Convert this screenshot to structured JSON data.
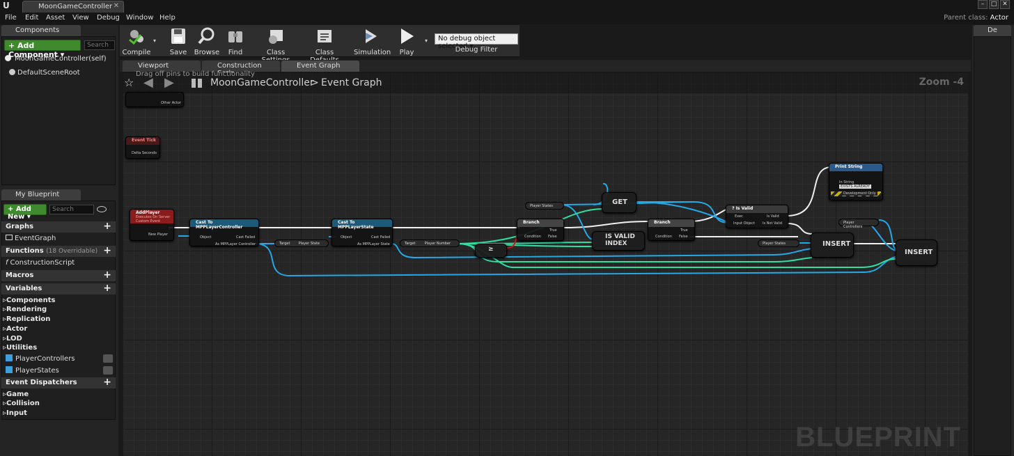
{
  "title_bar": {
    "logo": "unreal-logo",
    "tab": "MoonGameController",
    "window_buttons": [
      "–",
      "□",
      "✕"
    ]
  },
  "menu": {
    "items": [
      "File",
      "Edit",
      "Asset",
      "View",
      "Debug",
      "Window",
      "Help"
    ],
    "parent_class_label": "Parent class:",
    "parent_class_value": "Actor"
  },
  "components": {
    "tab": "Components",
    "add_button": "+ Add Component ▾",
    "search_placeholder": "Search",
    "items": [
      "MoonGameController(self)",
      "DefaultSceneRoot"
    ]
  },
  "my_blueprint": {
    "tab": "My Blueprint",
    "add_new": "+ Add New ▾",
    "search_placeholder": "Search",
    "graphs": "Graphs",
    "event_graph": "EventGraph",
    "functions": "Functions",
    "functions_count": "(18 Overridable)",
    "construction_script": "ConstructionScript",
    "macros": "Macros",
    "variables": "Variables",
    "var_categories": [
      "Components",
      "Rendering",
      "Replication",
      "Actor",
      "LOD",
      "Utilities"
    ],
    "vars": [
      "PlayerControllers",
      "PlayerStates"
    ],
    "event_dispatchers": "Event Dispatchers",
    "dispatcher_categories": [
      "Game",
      "Collision",
      "Input"
    ]
  },
  "toolbar": {
    "compile": "Compile",
    "save": "Save",
    "browse": "Browse",
    "find": "Find",
    "class_settings": "Class Settings",
    "class_defaults": "Class Defaults",
    "simulation": "Simulation",
    "play": "Play",
    "debug_object": "No debug object selected ▾",
    "debug_filter": "Debug Filter"
  },
  "details_tab": "De",
  "graph_tabs": [
    "Viewport",
    "Construction Scrip",
    "Event Graph"
  ],
  "graph": {
    "hint": "Drag off pins to build functionality",
    "breadcrumb_root": "MoonGameController",
    "breadcrumb_sep": ">",
    "breadcrumb_current": "Event Graph",
    "zoom": "Zoom -4",
    "watermark": "BLUEPRINT"
  },
  "nodes": {
    "other_actor": "Other Actor",
    "event_tick": "Event Tick",
    "delta_seconds": "Delta Seconds",
    "add_player": {
      "title": "AddPlayer",
      "subtitle": "Executes On Server",
      "subtitle2": "Custom Event",
      "pin": "New Player"
    },
    "cast_pc": {
      "title": "Cast To MPPLayerController",
      "object": "Object",
      "failed": "Cast Failed",
      "as": "As MPPLayer Controller"
    },
    "target_ps": {
      "target": "Target",
      "value": "Player State"
    },
    "cast_ps": {
      "title": "Cast To MPPLayerState",
      "object": "Object",
      "failed": "Cast Failed",
      "as": "As MPPLayer State"
    },
    "target_pn": {
      "target": "Target",
      "value": "Player Number"
    },
    "branch1": {
      "title": "Branch",
      "condition": "Condition",
      "true": "True",
      "false": "False"
    },
    "player_states_get": "Player States",
    "get": "GET",
    "is_valid_index": "IS VALID INDEX",
    "branch2": {
      "title": "Branch",
      "condition": "Condition",
      "true": "True",
      "false": "False"
    },
    "is_valid": {
      "title": "? Is Valid",
      "exec": "Exec",
      "input": "Input Object",
      "valid": "Is Valid",
      "not_valid": "Is Not Valid"
    },
    "print_string": {
      "title": "Print String",
      "in_string": "In String",
      "value": "EXISTS ALREADY",
      "dev": "Development Only"
    },
    "player_states2": "Player States",
    "insert1": "INSERT",
    "player_controllers": "Player Controllers",
    "insert2": "INSERT",
    "compare": "≥"
  }
}
